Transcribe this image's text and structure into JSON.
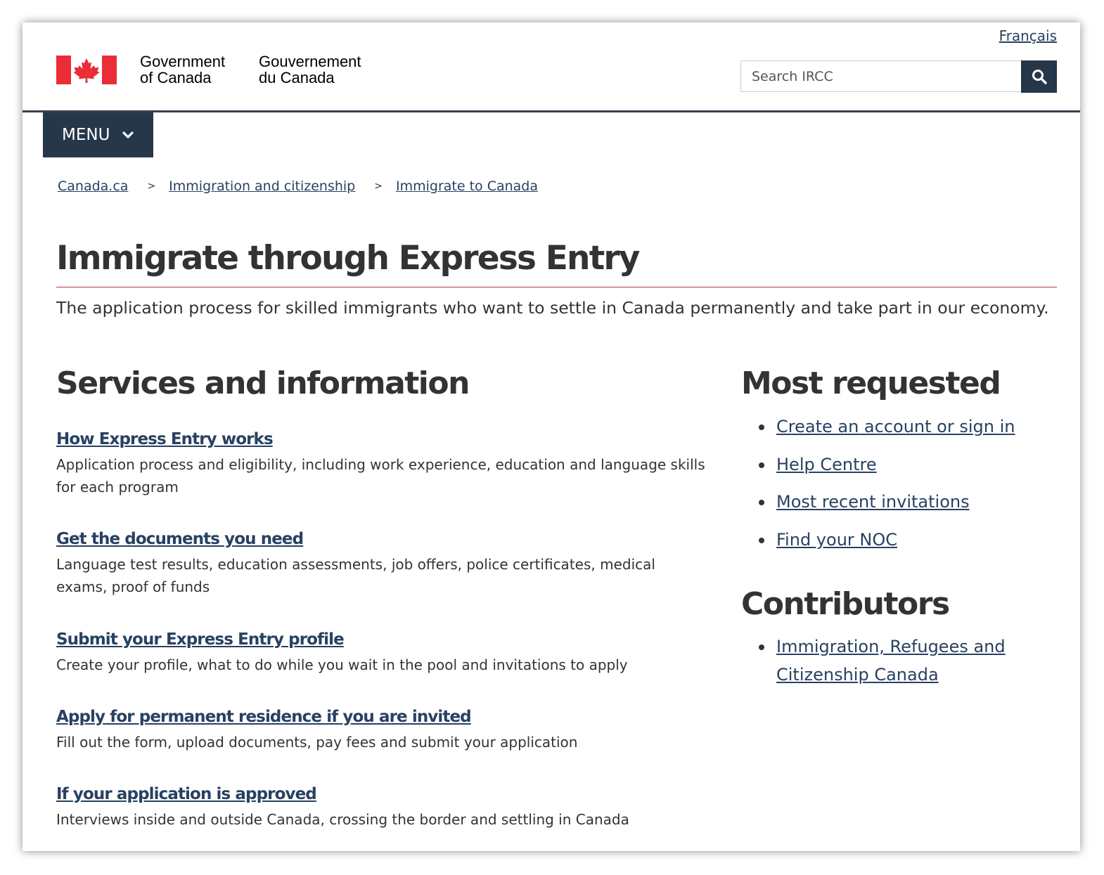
{
  "header": {
    "language_link": "Français",
    "signature_en_line1": "Government",
    "signature_en_line2": "of Canada",
    "signature_fr_line1": "Gouvernement",
    "signature_fr_line2": "du Canada",
    "search_placeholder": "Search IRCC",
    "menu_label": "MENU"
  },
  "breadcrumb": {
    "items": [
      "Canada.ca",
      "Immigration and citizenship",
      "Immigrate to Canada"
    ],
    "separator": ">"
  },
  "page": {
    "title": "Immigrate through Express Entry",
    "lead": "The application process for skilled immigrants who want to settle in Canada permanently and take part in our economy."
  },
  "services": {
    "heading": "Services and information",
    "items": [
      {
        "title": "How Express Entry works",
        "description": "Application process and eligibility, including work experience, education and language skills for each program"
      },
      {
        "title": "Get the documents you need",
        "description": "Language test results, education assessments, job offers, police certificates, medical exams, proof of funds"
      },
      {
        "title": "Submit your Express Entry profile",
        "description": "Create your profile, what to do while you wait in the pool and invitations to apply"
      },
      {
        "title": "Apply for permanent residence if you are invited",
        "description": "Fill out the form, upload documents, pay fees and submit your application"
      },
      {
        "title": "If your application is approved",
        "description": "Interviews inside and outside Canada, crossing the border and settling in Canada"
      }
    ]
  },
  "most_requested": {
    "heading": "Most requested",
    "items": [
      "Create an account or sign in",
      "Help Centre",
      "Most recent invitations",
      "Find your NOC"
    ]
  },
  "contributors": {
    "heading": "Contributors",
    "items": [
      "Immigration, Refugees and Citizenship Canada"
    ]
  },
  "colors": {
    "link": "#284162",
    "text": "#333333",
    "navy": "#26374a",
    "flag_red": "#eb2d37",
    "title_rule": "#af3c43"
  },
  "icons": {
    "search": "search-icon",
    "menu_chevron": "chevron-down-icon",
    "flag": "canada-flag-icon"
  }
}
